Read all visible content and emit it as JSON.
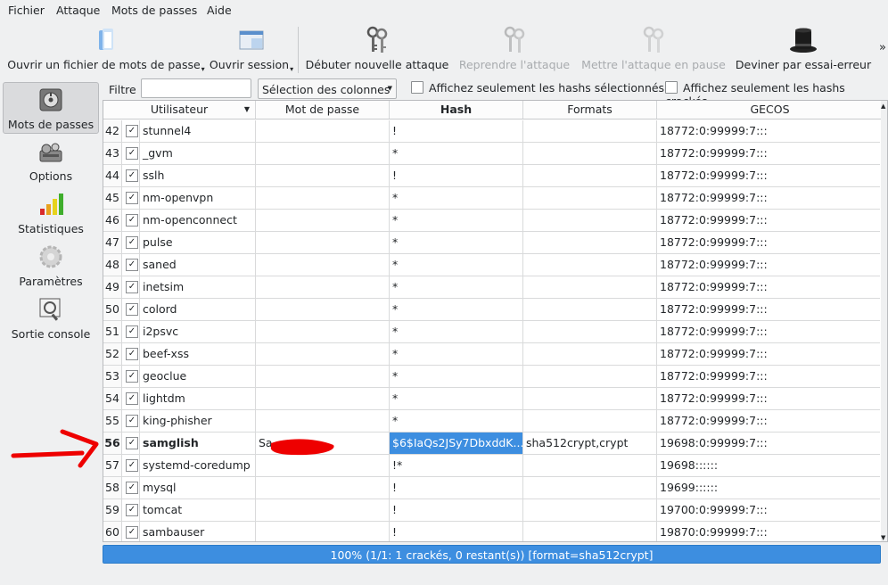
{
  "menu": [
    "Fichier",
    "Attaque",
    "Mots de passes",
    "Aide"
  ],
  "toolbar": {
    "open_file": "Ouvrir un fichier de mots de passe",
    "open_session": "Ouvrir session",
    "start_attack": "Débuter nouvelle attaque",
    "resume_attack": "Reprendre l'attaque",
    "pause_attack": "Mettre l'attaque en pause",
    "guess": "Deviner par essai-erreur",
    "overflow": "»"
  },
  "sidebar": [
    {
      "label": "Mots de passes",
      "icon": "lock-icon",
      "active": true
    },
    {
      "label": "Options",
      "icon": "gear-tray-icon",
      "active": false
    },
    {
      "label": "Statistiques",
      "icon": "bar-chart-icon",
      "active": false
    },
    {
      "label": "Paramètres",
      "icon": "cog-icon",
      "active": false
    },
    {
      "label": "Sortie console",
      "icon": "console-icon",
      "active": false
    }
  ],
  "filterbar": {
    "filter_label": "Filtre",
    "filter_value": "",
    "column_select": "Sélection des colonnes",
    "show_selected": "Affichez seulement les hashs sélectionnés",
    "show_cracked": "Affichez seulement les hashs crackés"
  },
  "table": {
    "headers": [
      "Utilisateur",
      "Mot de passe",
      "Hash",
      "Formats",
      "GECOS"
    ],
    "rows": [
      {
        "n": "42",
        "user": "stunnel4",
        "pass": "",
        "hash": "!",
        "fmt": "",
        "gecos": "18772:0:99999:7:::"
      },
      {
        "n": "43",
        "user": "_gvm",
        "pass": "",
        "hash": "*",
        "fmt": "",
        "gecos": "18772:0:99999:7:::"
      },
      {
        "n": "44",
        "user": "sslh",
        "pass": "",
        "hash": "!",
        "fmt": "",
        "gecos": "18772:0:99999:7:::"
      },
      {
        "n": "45",
        "user": "nm-openvpn",
        "pass": "",
        "hash": "*",
        "fmt": "",
        "gecos": "18772:0:99999:7:::"
      },
      {
        "n": "46",
        "user": "nm-openconnect",
        "pass": "",
        "hash": "*",
        "fmt": "",
        "gecos": "18772:0:99999:7:::"
      },
      {
        "n": "47",
        "user": "pulse",
        "pass": "",
        "hash": "*",
        "fmt": "",
        "gecos": "18772:0:99999:7:::"
      },
      {
        "n": "48",
        "user": "saned",
        "pass": "",
        "hash": "*",
        "fmt": "",
        "gecos": "18772:0:99999:7:::"
      },
      {
        "n": "49",
        "user": "inetsim",
        "pass": "",
        "hash": "*",
        "fmt": "",
        "gecos": "18772:0:99999:7:::"
      },
      {
        "n": "50",
        "user": "colord",
        "pass": "",
        "hash": "*",
        "fmt": "",
        "gecos": "18772:0:99999:7:::"
      },
      {
        "n": "51",
        "user": "i2psvc",
        "pass": "",
        "hash": "*",
        "fmt": "",
        "gecos": "18772:0:99999:7:::"
      },
      {
        "n": "52",
        "user": "beef-xss",
        "pass": "",
        "hash": "*",
        "fmt": "",
        "gecos": "18772:0:99999:7:::"
      },
      {
        "n": "53",
        "user": "geoclue",
        "pass": "",
        "hash": "*",
        "fmt": "",
        "gecos": "18772:0:99999:7:::"
      },
      {
        "n": "54",
        "user": "lightdm",
        "pass": "",
        "hash": "*",
        "fmt": "",
        "gecos": "18772:0:99999:7:::"
      },
      {
        "n": "55",
        "user": "king-phisher",
        "pass": "",
        "hash": "*",
        "fmt": "",
        "gecos": "18772:0:99999:7:::"
      },
      {
        "n": "56",
        "user": "samglish",
        "pass": "Sa",
        "hash": "$6$IaQs2JSy7DbxddK...",
        "fmt": "sha512crypt,crypt",
        "gecos": "19698:0:99999:7:::",
        "bold": true,
        "hash_selected": true
      },
      {
        "n": "57",
        "user": "systemd-coredump",
        "pass": "",
        "hash": "!*",
        "fmt": "",
        "gecos": "19698::::::"
      },
      {
        "n": "58",
        "user": "mysql",
        "pass": "",
        "hash": "!",
        "fmt": "",
        "gecos": "19699::::::"
      },
      {
        "n": "59",
        "user": "tomcat",
        "pass": "",
        "hash": "!",
        "fmt": "",
        "gecos": "19700:0:99999:7:::"
      },
      {
        "n": "60",
        "user": "sambauser",
        "pass": "",
        "hash": "!",
        "fmt": "",
        "gecos": "19870:0:99999:7:::"
      }
    ]
  },
  "progress": {
    "value": 1.0,
    "text": "100% (1/1: 1 crackés, 0 restant(s)) [format=sha512crypt]"
  },
  "colors": {
    "accent": "#3d8ee0",
    "annotation_red": "#ee0000"
  }
}
